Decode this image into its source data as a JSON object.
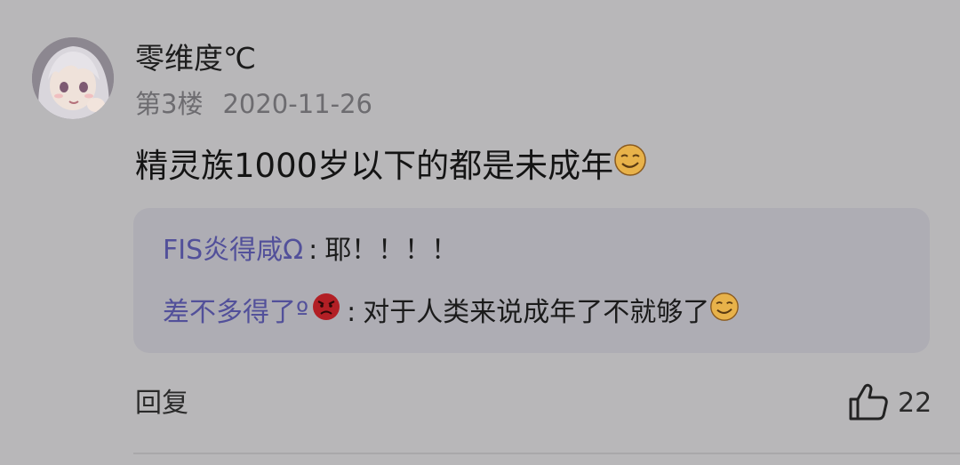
{
  "comment": {
    "username": "零维度℃",
    "floor": "第3楼",
    "date": "2020-11-26",
    "content_text": "精灵族1000岁以下的都是未成年",
    "content_emoji": "smirk-face-emoji",
    "replies": [
      {
        "name": "FIS炎得咸Ω",
        "separator": ":",
        "text": "耶！！！！"
      },
      {
        "name": "差不多得了º",
        "name_emoji": "angry-face-emoji",
        "separator": ":",
        "text": "对于人类来说成年了不就够了",
        "text_emoji": "smirk-face-emoji"
      }
    ],
    "reply_label": "回复",
    "like_icon": "thumbs-up-icon",
    "like_count": "22"
  },
  "colors": {
    "background": "#b8b7b9",
    "reply_box": "#aeadb4",
    "reply_name": "#52509a",
    "meta_text": "#6d6c70"
  }
}
